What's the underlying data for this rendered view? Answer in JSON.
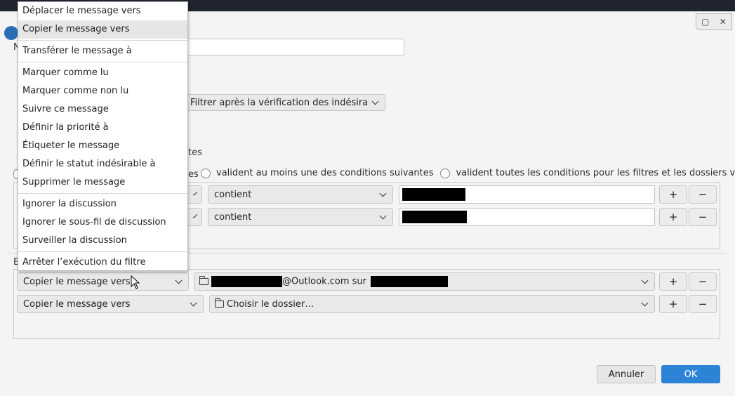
{
  "window": {
    "controls": [
      "▢",
      "✕"
    ]
  },
  "fragments": {
    "name_initial": "N",
    "actions_initial": "E",
    "conditions_frag": "tes",
    "radio1_frag": "es"
  },
  "filter_timing": {
    "label": "Filtrer après la vérification des indésira…"
  },
  "match": {
    "option_any": "valident au moins une des conditions suivantes",
    "option_all_virtual": "valident toutes les conditions pour les filtres et les dossiers virtuels"
  },
  "conditions": [
    {
      "operator": "contient",
      "add": "+",
      "remove": "−"
    },
    {
      "operator": "contient",
      "add": "+",
      "remove": "−"
    }
  ],
  "actions": [
    {
      "action": "Copier le message vers",
      "target_suffix": "@Outlook.com sur",
      "add": "+",
      "remove": "−"
    },
    {
      "action": "Copier le message vers",
      "target": "Choisir le dossier…",
      "add": "+",
      "remove": "−"
    }
  ],
  "menu": {
    "items": [
      "Déplacer le message vers",
      "Copier le message vers",
      "Transférer le message à",
      "Marquer comme lu",
      "Marquer comme non lu",
      "Suivre ce message",
      "Définir la priorité à",
      "Étiqueter le message",
      "Définir le statut indésirable à",
      "Supprimer le message",
      "Ignorer la discussion",
      "Ignorer le sous-fil de discussion",
      "Surveiller la discussion",
      "Arrêter l’exécution du filtre"
    ]
  },
  "footer": {
    "cancel": "Annuler",
    "ok": "OK"
  }
}
